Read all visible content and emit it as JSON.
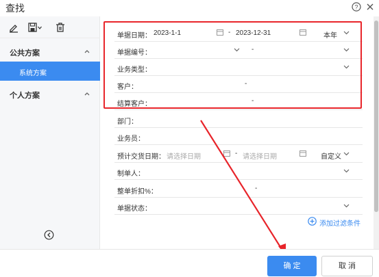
{
  "dialog": {
    "title": "查找"
  },
  "sidebar": {
    "public_group": "公共方案",
    "system_scheme": "系统方案",
    "personal_group": "个人方案"
  },
  "filters": {
    "doc_date": {
      "label": "单据日期：",
      "start": "2023-1-1",
      "end": "2023-12-31",
      "period": "本年"
    },
    "doc_no": {
      "label": "单据编号："
    },
    "biz_type": {
      "label": "业务类型："
    },
    "customer": {
      "label": "客户："
    },
    "settle_customer": {
      "label": "结算客户："
    },
    "department": {
      "label": "部门："
    },
    "salesman": {
      "label": "业务员："
    },
    "delivery_date": {
      "label": "预计交货日期：",
      "start_placeholder": "请选择日期",
      "end_placeholder": "请选择日期",
      "period": "自定义"
    },
    "creator": {
      "label": "制单人："
    },
    "discount": {
      "label": "整单折扣%："
    },
    "status": {
      "label": "单据状态："
    },
    "range_dash": "-"
  },
  "add_filter": "添加过滤条件",
  "footer": {
    "ok": "确 定",
    "cancel": "取 消"
  },
  "colors": {
    "primary": "#3b8bf0",
    "highlight": "#e8242a"
  }
}
